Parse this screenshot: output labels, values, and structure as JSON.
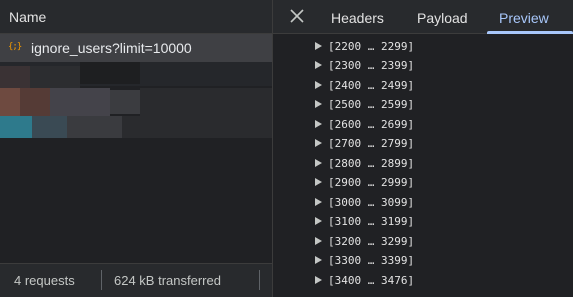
{
  "network": {
    "name_column_header": "Name",
    "request": {
      "icon": "json-icon",
      "icon_glyph": "{;}",
      "name": "ignore_users?limit=10000"
    },
    "status": {
      "requests": "4 requests",
      "transferred": "624 kB transferred"
    }
  },
  "details": {
    "tabs": [
      {
        "label": "Headers"
      },
      {
        "label": "Payload"
      },
      {
        "label": "Preview"
      }
    ],
    "active_tab": "Preview",
    "preview": {
      "rows": [
        "[2200 … 2299]",
        "[2300 … 2399]",
        "[2400 … 2499]",
        "[2500 … 2599]",
        "[2600 … 2699]",
        "[2700 … 2799]",
        "[2800 … 2899]",
        "[2900 … 2999]",
        "[3000 … 3099]",
        "[3100 … 3199]",
        "[3200 … 3299]",
        "[3300 … 3399]",
        "[3400 … 3476]"
      ]
    }
  },
  "colors": {
    "background": "#202124",
    "accent": "#a8c7fa",
    "json_icon": "#f29900",
    "selected_row": "#3f4044"
  }
}
